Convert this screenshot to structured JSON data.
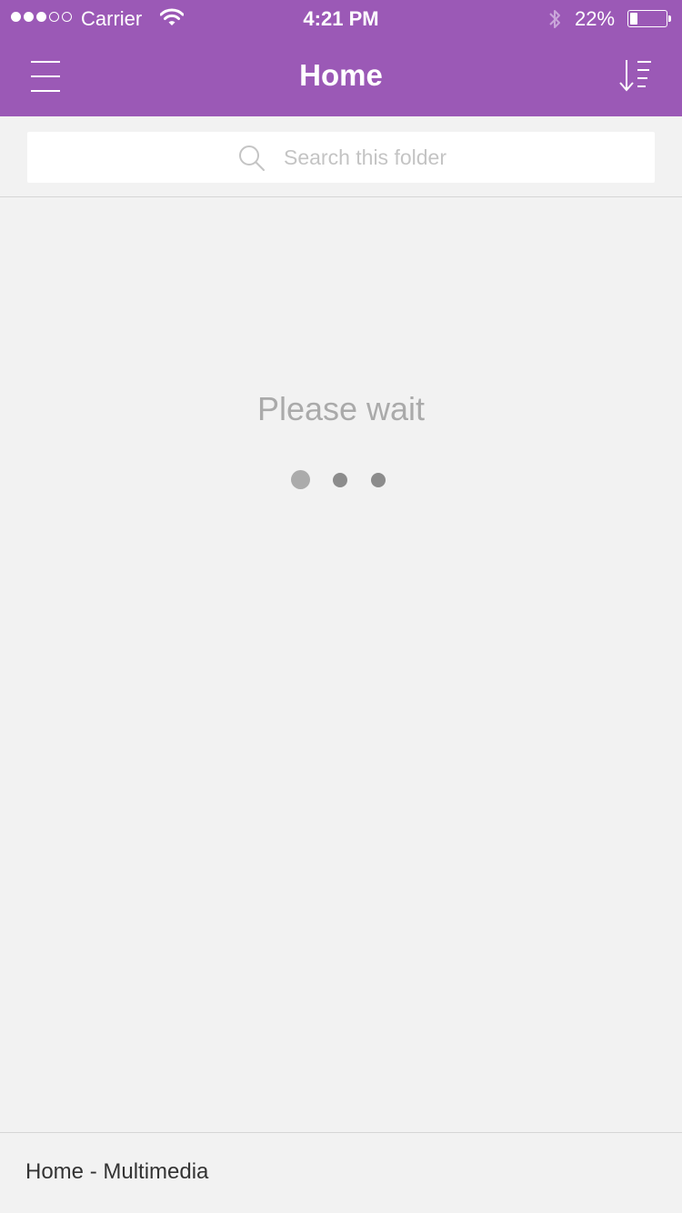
{
  "status_bar": {
    "carrier": "Carrier",
    "time": "4:21 PM",
    "battery_percent": "22%",
    "battery_level": 0.22,
    "signal_bars_filled": 3,
    "signal_bars_total": 5,
    "icons": [
      "signal-icon",
      "wifi-icon",
      "bluetooth-icon",
      "battery-icon"
    ]
  },
  "nav": {
    "title": "Home",
    "left_icon": "hamburger-menu-icon",
    "right_icon": "sort-icon"
  },
  "search": {
    "placeholder": "Search this folder",
    "value": "",
    "icon": "search-icon"
  },
  "loading": {
    "message": "Please wait",
    "dots": 3
  },
  "footer": {
    "path": "Home - Multimedia"
  },
  "colors": {
    "accent": "#9b59b6",
    "background": "#f2f2f2",
    "loader_dot": "#8c8c8c",
    "placeholder": "#c4c4c4",
    "wait_text": "#aaaaaa"
  }
}
